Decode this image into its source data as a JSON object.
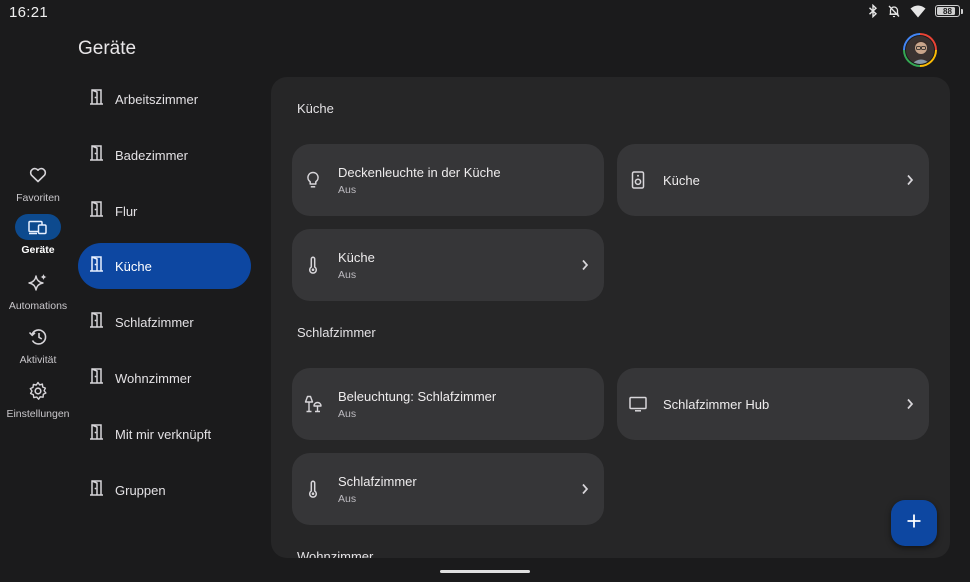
{
  "status_bar": {
    "time": "16:21",
    "battery": "88",
    "battery_level": 0.88,
    "icons": [
      "bluetooth-icon",
      "bell-off-icon",
      "wifi-icon",
      "battery-icon"
    ]
  },
  "header": {
    "title": "Geräte",
    "avatar": "user-avatar"
  },
  "nav_rail": [
    {
      "label": "Favoriten",
      "icon": "heart-icon",
      "active": false
    },
    {
      "label": "Geräte",
      "icon": "devices-icon",
      "active": true
    },
    {
      "label": "Automations",
      "icon": "sparkle-icon",
      "active": false
    },
    {
      "label": "Aktivität",
      "icon": "history-icon",
      "active": false
    },
    {
      "label": "Einstellungen",
      "icon": "gear-icon",
      "active": false
    }
  ],
  "rooms": [
    {
      "label": "Arbeitszimmer",
      "icon": "door-icon",
      "active": false
    },
    {
      "label": "Badezimmer",
      "icon": "door-icon",
      "active": false
    },
    {
      "label": "Flur",
      "icon": "door-icon",
      "active": false
    },
    {
      "label": "Küche",
      "icon": "door-icon",
      "active": true
    },
    {
      "label": "Schlafzimmer",
      "icon": "door-icon",
      "active": false
    },
    {
      "label": "Wohnzimmer",
      "icon": "door-icon",
      "active": false
    },
    {
      "label": "Mit mir verknüpft",
      "icon": "door-icon",
      "active": false
    },
    {
      "label": "Gruppen",
      "icon": "door-icon",
      "active": false
    }
  ],
  "sections": [
    {
      "title": "Küche",
      "devices": [
        {
          "name": "Deckenleuchte in der Küche",
          "status": "Aus",
          "icon": "lightbulb-icon"
        },
        {
          "name": "Küche",
          "status": "",
          "icon": "speaker-icon"
        },
        {
          "name": "Küche",
          "status": "Aus",
          "icon": "thermometer-icon"
        }
      ]
    },
    {
      "title": "Schlafzimmer",
      "devices": [
        {
          "name": "Beleuchtung: Schlafzimmer",
          "status": "Aus",
          "icon": "lamps-icon"
        },
        {
          "name": "Schlafzimmer Hub",
          "status": "",
          "icon": "display-icon"
        },
        {
          "name": "Schlafzimmer",
          "status": "Aus",
          "icon": "thermometer-icon"
        }
      ]
    },
    {
      "title": "Wohnzimmer",
      "devices": []
    }
  ],
  "fab": {
    "icon": "plus-icon"
  },
  "colors": {
    "background": "#1b1b1c",
    "panel": "#262627",
    "card": "#363638",
    "accent": "#0d47a1"
  }
}
